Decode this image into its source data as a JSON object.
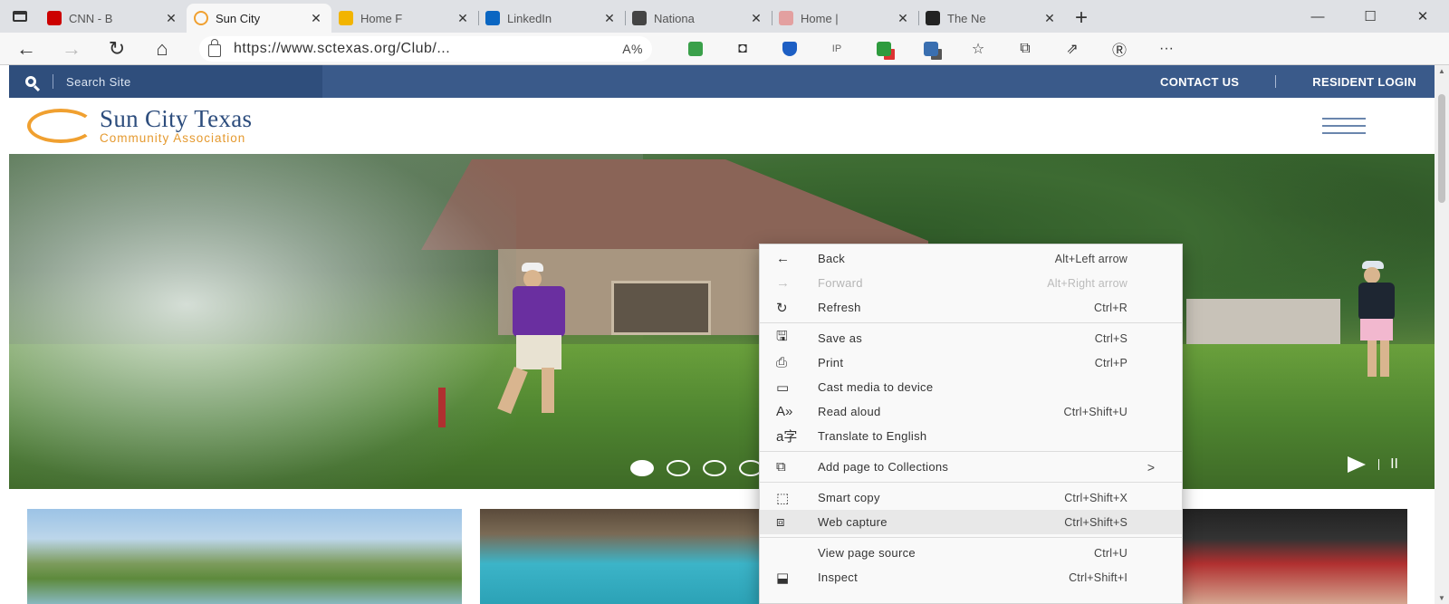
{
  "browser": {
    "tabs": [
      {
        "title": "CNN - B",
        "icon": "cnn-icon",
        "color": "#cc0000",
        "active": false
      },
      {
        "title": "Sun City",
        "icon": "suncity-icon",
        "color": "#f0a030",
        "active": true
      },
      {
        "title": "Home F",
        "icon": "home-icon",
        "color": "#f2b400",
        "active": false
      },
      {
        "title": "LinkedIn",
        "icon": "linkedin-icon",
        "color": "#0a66c2",
        "active": false
      },
      {
        "title": "Nationa",
        "icon": "news-icon",
        "color": "#444444",
        "active": false
      },
      {
        "title": "Home |",
        "icon": "home-icon",
        "color": "#e3a0a0",
        "active": false
      },
      {
        "title": "The Ne",
        "icon": "nyt-icon",
        "color": "#222222",
        "active": false
      }
    ],
    "tab_close_glyph": "✕",
    "new_tab_glyph": "+",
    "window_controls": {
      "minimize": "—",
      "maximize": "☐",
      "close": "✕"
    },
    "nav": {
      "back": "←",
      "forward": "→",
      "refresh": "↻",
      "home": "⌂"
    },
    "url": "https://www.sctexas.org/Club/...",
    "read_aloud_glyph": "A%",
    "toolbar_icons": [
      "green-ext-icon",
      "shield-icon",
      "bitwarden-icon",
      "ip-icon",
      "red-ext-icon",
      "mail-ext-icon",
      "favorites-icon",
      "collections-icon",
      "share-icon",
      "profile-icon",
      "more-icon"
    ],
    "toolbar_glyphs": {
      "shield": "◘",
      "ip": "IP",
      "favorites": "☆",
      "collections": "⧉",
      "share": "⇗",
      "profile": "Ⓡ",
      "more": "···"
    }
  },
  "site": {
    "search_placeholder": "Search Site",
    "contact_us": "CONTACT US",
    "resident_login": "RESIDENT LOGIN",
    "logo_main": "Sun City Texas",
    "logo_sub": "Community Association",
    "hero_slides": 5,
    "hero_controls": {
      "play": "",
      "pause": "II"
    }
  },
  "context_menu": {
    "items": [
      {
        "label": "Back",
        "shortcut": "Alt+Left arrow",
        "icon": "back-arrow-icon",
        "glyph": "←",
        "disabled": false
      },
      {
        "label": "Forward",
        "shortcut": "Alt+Right arrow",
        "icon": "forward-arrow-icon",
        "glyph": "→",
        "disabled": true
      },
      {
        "label": "Refresh",
        "shortcut": "Ctrl+R",
        "icon": "refresh-icon",
        "glyph": "↻",
        "disabled": false
      },
      {
        "separator": true
      },
      {
        "label": "Save as",
        "shortcut": "Ctrl+S",
        "icon": "save-as-icon",
        "glyph": "🖫",
        "disabled": false
      },
      {
        "label": "Print",
        "shortcut": "Ctrl+P",
        "icon": "print-icon",
        "glyph": "⎙",
        "disabled": false
      },
      {
        "label": "Cast media to device",
        "shortcut": "",
        "icon": "cast-icon",
        "glyph": "▭",
        "disabled": false
      },
      {
        "label": "Read aloud",
        "shortcut": "Ctrl+Shift+U",
        "icon": "read-aloud-icon",
        "glyph": "A»",
        "disabled": false
      },
      {
        "label": "Translate to English",
        "shortcut": "",
        "icon": "translate-icon",
        "glyph": "a字",
        "disabled": false
      },
      {
        "separator": true
      },
      {
        "label": "Add page to Collections",
        "shortcut": "",
        "icon": "collections-icon",
        "glyph": "⧉",
        "disabled": false,
        "submenu": ">"
      },
      {
        "separator": true
      },
      {
        "label": "Smart copy",
        "shortcut": "Ctrl+Shift+X",
        "icon": "smart-copy-icon",
        "glyph": "⬚",
        "disabled": false
      },
      {
        "label": "Web capture",
        "shortcut": "Ctrl+Shift+S",
        "icon": "web-capture-icon",
        "glyph": "⧈",
        "disabled": false,
        "hover": true
      },
      {
        "separator": true
      },
      {
        "label": "View page source",
        "shortcut": "Ctrl+U",
        "icon": "",
        "glyph": "",
        "disabled": false
      },
      {
        "label": "Inspect",
        "shortcut": "Ctrl+Shift+I",
        "icon": "inspect-icon",
        "glyph": "⬓",
        "disabled": false
      }
    ]
  },
  "colors": {
    "site_nav": "#3a5a8a",
    "logo_blue": "#2d4d7d",
    "logo_orange": "#e59a30"
  }
}
